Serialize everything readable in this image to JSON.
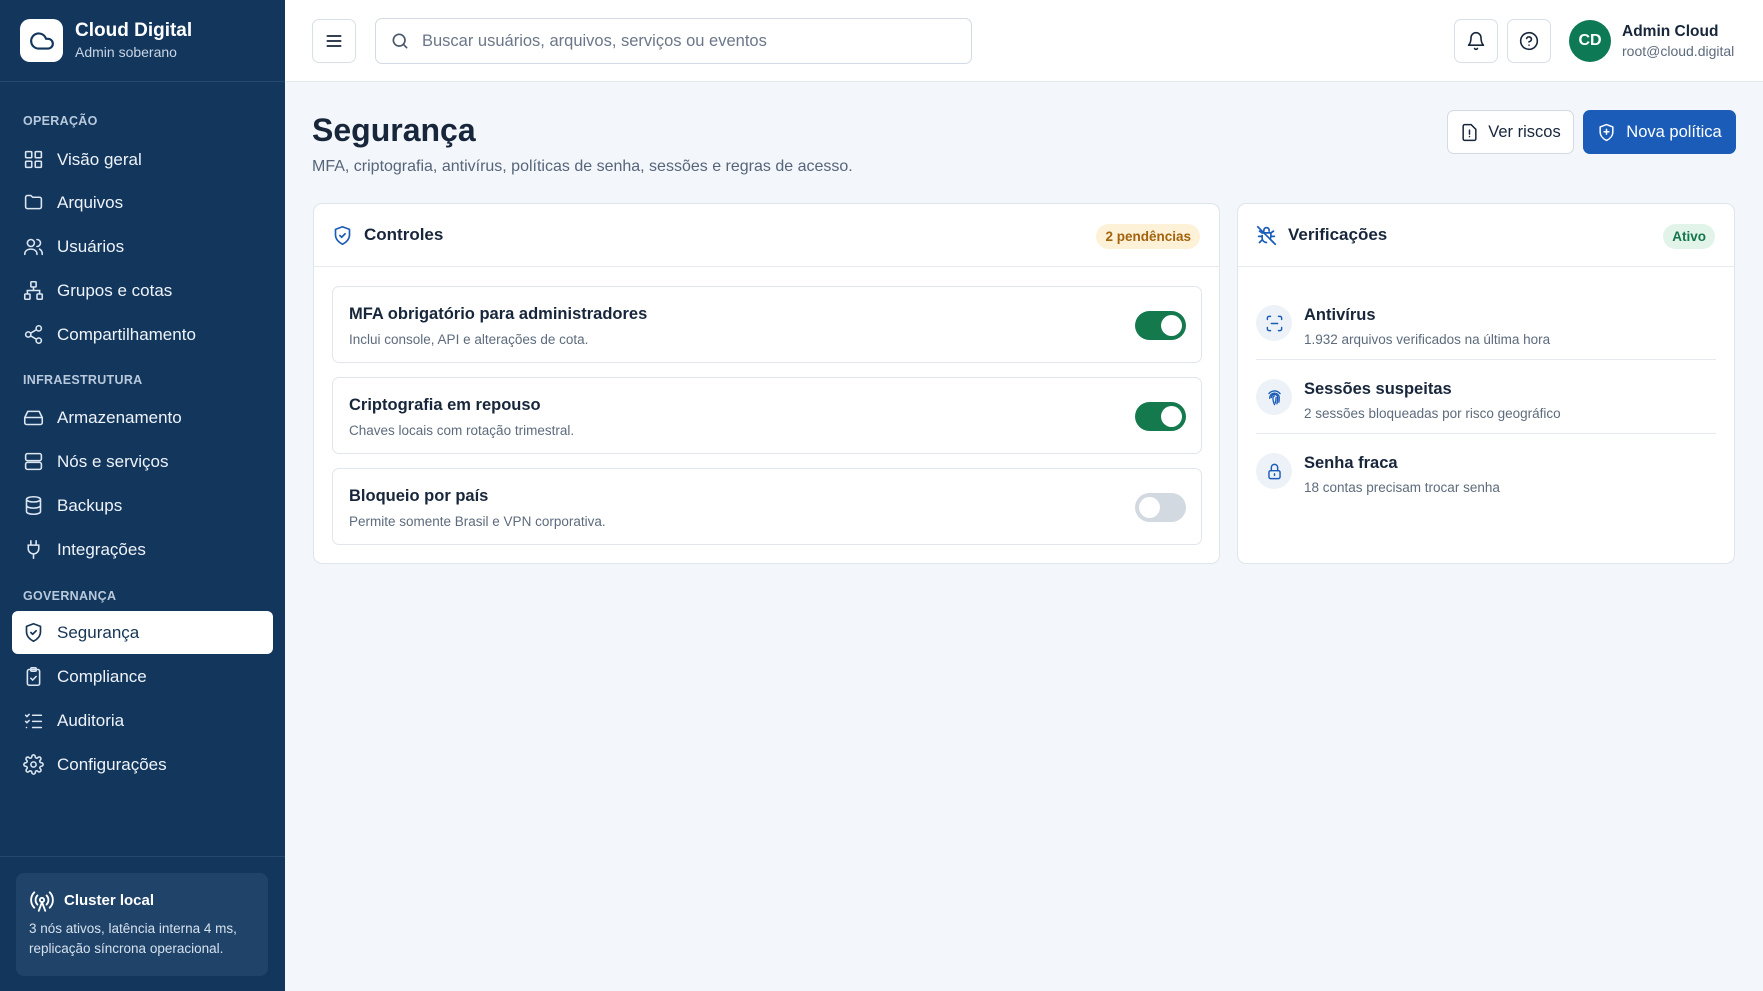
{
  "brand": {
    "title": "Cloud Digital",
    "subtitle": "Admin soberano"
  },
  "sidebar": {
    "sections": [
      {
        "label": "OPERAÇÃO"
      },
      {
        "label": "INFRAESTRUTURA"
      },
      {
        "label": "GOVERNANÇA"
      }
    ],
    "items": [
      {
        "label": "Visão geral",
        "icon": "grid-icon"
      },
      {
        "label": "Arquivos",
        "icon": "folder-icon"
      },
      {
        "label": "Usuários",
        "icon": "users-icon"
      },
      {
        "label": "Grupos e cotas",
        "icon": "network-icon"
      },
      {
        "label": "Compartilhamento",
        "icon": "share-icon"
      },
      {
        "label": "Armazenamento",
        "icon": "hard-drive-icon"
      },
      {
        "label": "Nós e serviços",
        "icon": "server-icon"
      },
      {
        "label": "Backups",
        "icon": "database-icon"
      },
      {
        "label": "Integrações",
        "icon": "plug-icon"
      },
      {
        "label": "Segurança",
        "icon": "shield-icon",
        "active": true
      },
      {
        "label": "Compliance",
        "icon": "clipboard-check-icon"
      },
      {
        "label": "Auditoria",
        "icon": "list-checks-icon"
      },
      {
        "label": "Configurações",
        "icon": "gear-icon"
      }
    ],
    "cluster": {
      "title": "Cluster local",
      "text": "3 nós ativos, latência interna 4 ms, replicação síncrona operacional."
    }
  },
  "topbar": {
    "search_placeholder": "Buscar usuários, arquivos, serviços ou eventos",
    "user": {
      "initials": "CD",
      "name": "Admin Cloud",
      "email": "root@cloud.digital"
    }
  },
  "page": {
    "title": "Segurança",
    "subtitle": "MFA, criptografia, antivírus, políticas de senha, sessões e regras de acesso.",
    "actions": {
      "risks": "Ver riscos",
      "new_policy": "Nova política"
    }
  },
  "controls": {
    "title": "Controles",
    "badge": "2 pendências",
    "items": [
      {
        "title": "MFA obrigatório para administradores",
        "desc": "Inclui console, API e alterações de cota.",
        "enabled": true
      },
      {
        "title": "Criptografia em repouso",
        "desc": "Chaves locais com rotação trimestral.",
        "enabled": true
      },
      {
        "title": "Bloqueio por país",
        "desc": "Permite somente Brasil e VPN corporativa.",
        "enabled": false
      }
    ]
  },
  "checks": {
    "title": "Verificações",
    "badge": "Ativo",
    "items": [
      {
        "title": "Antivírus",
        "desc": "1.932 arquivos verificados na última hora",
        "icon": "scan-icon"
      },
      {
        "title": "Sessões suspeitas",
        "desc": "2 sessões bloqueadas por risco geográfico",
        "icon": "fingerprint-icon"
      },
      {
        "title": "Senha fraca",
        "desc": "18 contas precisam trocar senha",
        "icon": "lock-icon"
      }
    ]
  },
  "colors": {
    "sidebar": "#13365d",
    "primary": "#1a5cb8",
    "success": "#147a4e",
    "warning": "#a3620b"
  }
}
